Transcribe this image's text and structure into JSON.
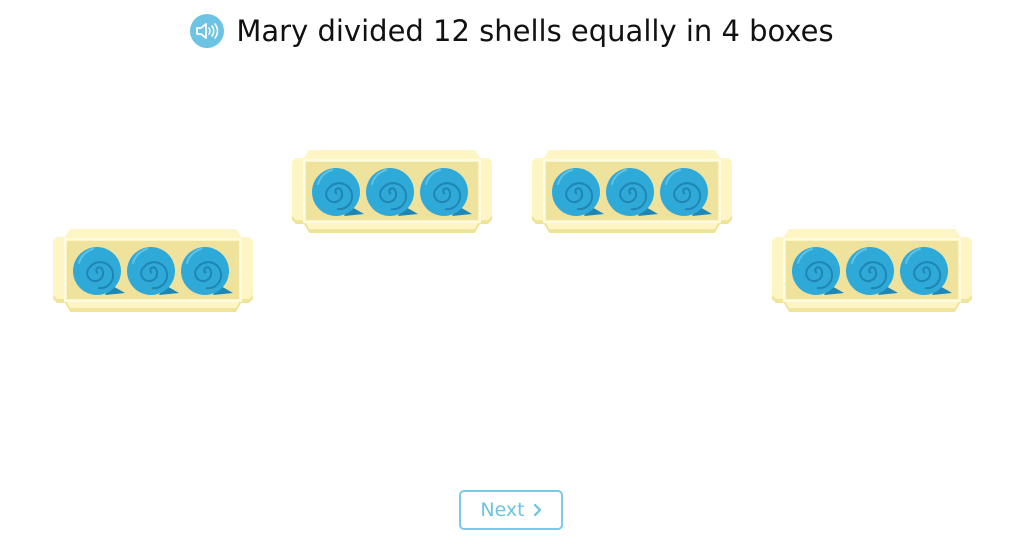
{
  "question": {
    "text": "Mary divided 12 shells equally in 4 boxes",
    "icon": "speaker-icon"
  },
  "boxes": [
    {
      "shells": 3
    },
    {
      "shells": 3
    },
    {
      "shells": 3
    },
    {
      "shells": 3
    }
  ],
  "next_button": {
    "label": "Next",
    "icon": "chevron-right-icon"
  },
  "colors": {
    "shell": "#2fa9d8",
    "box": "#fdf5c4",
    "box_inner": "#efe29c",
    "accent": "#6cc3e3"
  }
}
